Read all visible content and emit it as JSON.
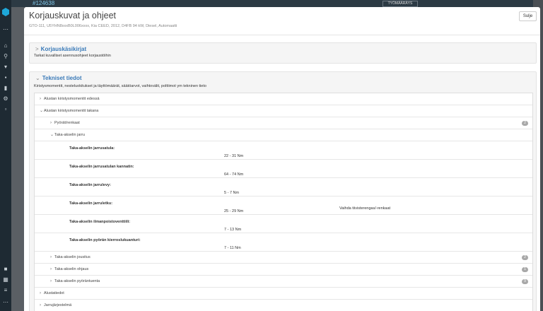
{
  "background": {
    "record_id": "#124638",
    "button_label": "TYÖMÄÄRÄYS"
  },
  "modal": {
    "title": "Korjauskuvat ja ohjeet",
    "subtitle": "GTO-111, U5YHN8xxxB0L006xxxx, Kia CEED, 2012, D4FB 94 kW, Diesel, Automaatti",
    "close_label": "Sulje"
  },
  "repair_manuals": {
    "title": "Korjauskäsikirjat",
    "description": "Tarkat kuvalliset asennusohjeet korjaustöihin"
  },
  "technical_data": {
    "title": "Tekniset tiedot",
    "description": "Kiristysmomentit, nesteluokitukset ja täyttömäärät, säätöarvot, vaihtovälit, polttimot ym tekninen tieto",
    "rows": [
      {
        "label": "Alustan kiristysmomentit edessä",
        "expanded": false,
        "level": 0
      },
      {
        "label": "Alustan kiristysmomentit takana",
        "expanded": true,
        "level": 0
      },
      {
        "label": "Pyörät/renkaat",
        "expanded": false,
        "level": 1,
        "badge": "2"
      },
      {
        "label": "Taka-akselin jarru",
        "expanded": true,
        "level": 1
      }
    ],
    "details": [
      {
        "name": "Taka-akselin jarrusatula:",
        "value": "22 - 31 Nm",
        "note": ""
      },
      {
        "name": "Taka-akselin jarrusatulan kannatin:",
        "value": "64 - 74 Nm",
        "note": ""
      },
      {
        "name": "Taka-akselin jarrulevy:",
        "value": "5 - 7 Nm",
        "note": ""
      },
      {
        "name": "Taka-akselin jarruletku:",
        "value": "25 - 29 Nm",
        "note": "Vaihda tiivisterengas/-renkaat"
      },
      {
        "name": "Taka-akselin ilmanpoistoventtiili:",
        "value": "7 - 13 Nm",
        "note": ""
      },
      {
        "name": "Taka-akselin pyörän kierroslukuanturi:",
        "value": "7 - 11 Nm",
        "note": ""
      }
    ],
    "rows_after": [
      {
        "label": "Taka-akselin jousitus",
        "level": 1,
        "badge": "2"
      },
      {
        "label": "Taka-akselin ohjaus",
        "level": 1,
        "badge": "1"
      },
      {
        "label": "Taka-akselin pyöräntuenta",
        "level": 1,
        "badge": "9"
      },
      {
        "label": "Alustatiedot",
        "level": 0
      },
      {
        "label": "Jarrujärjestelmä",
        "level": 0
      }
    ]
  },
  "icons": {
    "collapsed": "chevron-right-icon",
    "expanded": "chevron-down-icon"
  },
  "colors": {
    "accent": "#3a7ab8",
    "badge": "#a8a8a8",
    "sidebar": "#1e2a33"
  }
}
